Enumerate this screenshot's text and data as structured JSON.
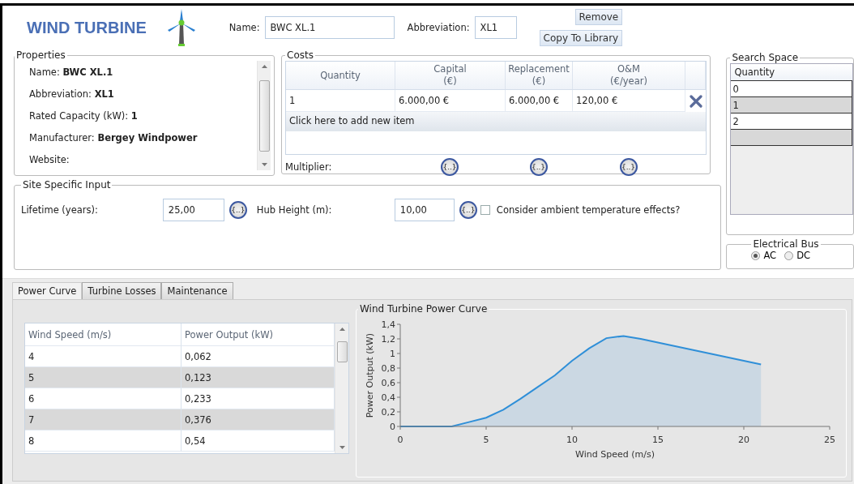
{
  "header": {
    "title": "WIND TURBINE",
    "name_label": "Name:",
    "name_value": "BWC XL.1",
    "abbreviation_label": "Abbreviation:",
    "abbreviation_value": "XL1",
    "buttons": [
      "Remove",
      "Copy To Library"
    ]
  },
  "properties": {
    "title": "Properties",
    "items": [
      "Name: **BWC XL.1**",
      "Abbreviation: **XL1**",
      "Rated Capacity (kW): **1**",
      "Manufacturer: **Bergey Windpower**",
      "Website:"
    ]
  },
  "costs": {
    "title": "Costs",
    "columns": [
      "Quantity",
      "Capital\n(€)",
      "Replacement\n(€)",
      "O&M\n(€/year)"
    ],
    "rows": [
      [
        "1",
        "6.000,00 €",
        "6.000,00 €",
        "120,00 €"
      ]
    ],
    "add_item": "Click here to add new item",
    "multiplier_label": "Multiplier:",
    "multiplier_buttons": [
      "{..}",
      "{..}",
      "{..}"
    ]
  },
  "site_input": {
    "title": "Site Specific Input",
    "lifetime_label": "Lifetime (years):",
    "lifetime_value": "25,00",
    "lifetime_button": "{..}",
    "hub_label": "Hub Height (m):",
    "hub_value": "10,00",
    "hub_button": "{..}",
    "ambient_label": "Consider ambient temperature effects?",
    "ambient_checked": false
  },
  "search_space": {
    "title": "Search Space",
    "column": "Quantity",
    "rows": [
      "0",
      "1",
      "2"
    ]
  },
  "electrical_bus": {
    "title": "Electrical Bus",
    "options": [
      {
        "label": "AC",
        "selected": true
      },
      {
        "label": "DC",
        "selected": false
      }
    ]
  },
  "tabs": [
    {
      "label": "Power Curve",
      "selected": true
    },
    {
      "label": "Turbine Losses",
      "selected": false
    },
    {
      "label": "Maintenance",
      "selected": false
    }
  ],
  "power_table": {
    "columns": [
      "Wind Speed (m/s)",
      "Power Output (kW)"
    ],
    "rows": [
      [
        "4",
        "0,062"
      ],
      [
        "5",
        "0,123"
      ],
      [
        "6",
        "0,233"
      ],
      [
        "7",
        "0,376"
      ],
      [
        "8",
        "0,54"
      ]
    ]
  },
  "chart": {
    "title": "Wind Turbine Power Curve",
    "chart_data": {
      "type": "area",
      "xlabel": "Wind Speed (m/s)",
      "ylabel": "Power Output (kW)",
      "x": [
        0,
        1,
        2,
        3,
        4,
        5,
        6,
        7,
        8,
        9,
        10,
        11,
        12,
        13,
        14,
        15,
        16,
        17,
        18,
        19,
        20,
        21
      ],
      "series": [
        {
          "color": "#2f8fd8",
          "values": [
            0,
            0,
            0,
            0,
            0.06,
            0.12,
            0.23,
            0.38,
            0.54,
            0.7,
            0.9,
            1.07,
            1.21,
            1.24,
            1.2,
            1.15,
            1.1,
            1.05,
            1.0,
            0.95,
            0.9,
            0.85
          ]
        }
      ],
      "xlim": [
        0,
        25
      ],
      "ylim": [
        0,
        1.4
      ],
      "xticks": [
        0,
        5,
        10,
        15,
        20,
        25
      ],
      "yticks": [
        {
          "value": 0,
          "label": "0"
        },
        {
          "value": 0.2,
          "label": "0,2"
        },
        {
          "value": 0.4,
          "label": "0,4"
        },
        {
          "value": 0.6,
          "label": "0,6"
        },
        {
          "value": 0.8,
          "label": "0,8"
        },
        {
          "value": 1,
          "label": "1"
        },
        {
          "value": 1.2,
          "label": "1,2"
        },
        {
          "value": 1.4,
          "label": "1,4"
        }
      ]
    }
  }
}
